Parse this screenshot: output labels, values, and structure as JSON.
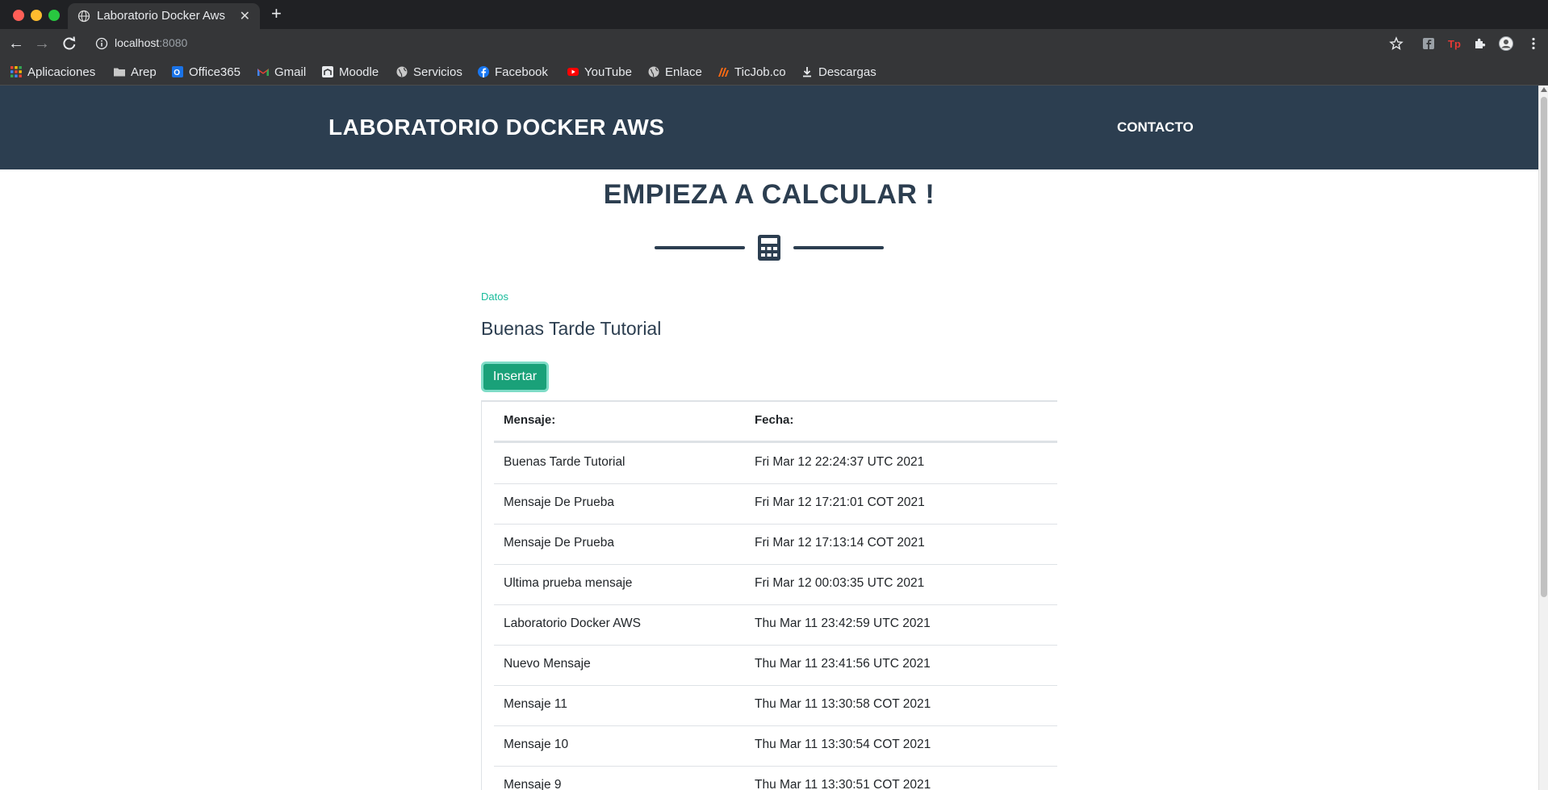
{
  "browser": {
    "tab_title": "Laboratorio Docker Aws",
    "new_tab": "+",
    "url_host": "localhost",
    "url_port": ":8080",
    "bookmarks": [
      {
        "label": "Aplicaciones",
        "icon": "apps-grid-icon"
      },
      {
        "label": "Arep",
        "icon": "folder-icon"
      },
      {
        "label": "Office365",
        "icon": "office365-icon"
      },
      {
        "label": "Gmail",
        "icon": "gmail-icon"
      },
      {
        "label": "Moodle",
        "icon": "moodle-icon"
      },
      {
        "label": "Servicios",
        "icon": "globe-icon"
      },
      {
        "label": "Facebook",
        "icon": "facebook-icon"
      },
      {
        "label": "YouTube",
        "icon": "youtube-icon"
      },
      {
        "label": "Enlace",
        "icon": "globe-icon"
      },
      {
        "label": "TicJob.co",
        "icon": "ticjob-icon"
      },
      {
        "label": "Descargas",
        "icon": "download-icon"
      }
    ]
  },
  "header": {
    "brand": "LABORATORIO DOCKER AWS",
    "nav_contact": "CONTACTO"
  },
  "main": {
    "title": "EMPIEZA A CALCULAR !",
    "small_label": "Datos",
    "welcome": "Buenas Tarde Tutorial",
    "insert_button": "Insertar",
    "table": {
      "headers": [
        "Mensaje:",
        "Fecha:"
      ],
      "rows": [
        {
          "mensaje": "Buenas Tarde Tutorial",
          "fecha": "Fri Mar 12 22:24:37 UTC 2021"
        },
        {
          "mensaje": "Mensaje De Prueba",
          "fecha": "Fri Mar 12 17:21:01 COT 2021"
        },
        {
          "mensaje": "Mensaje De Prueba",
          "fecha": "Fri Mar 12 17:13:14 COT 2021"
        },
        {
          "mensaje": "Ultima prueba mensaje",
          "fecha": "Fri Mar 12 00:03:35 UTC 2021"
        },
        {
          "mensaje": "Laboratorio Docker AWS",
          "fecha": "Thu Mar 11 23:42:59 UTC 2021"
        },
        {
          "mensaje": "Nuevo Mensaje",
          "fecha": "Thu Mar 11 23:41:56 UTC 2021"
        },
        {
          "mensaje": "Mensaje 11",
          "fecha": "Thu Mar 11 13:30:58 COT 2021"
        },
        {
          "mensaje": "Mensaje 10",
          "fecha": "Thu Mar 11 13:30:54 COT 2021"
        },
        {
          "mensaje": "Mensaje 9",
          "fecha": "Thu Mar 11 13:30:51 COT 2021"
        }
      ]
    }
  },
  "colors": {
    "header_bg": "#2c3e50",
    "accent_teal": "#1abc9c",
    "button_bg": "#1aa179"
  }
}
